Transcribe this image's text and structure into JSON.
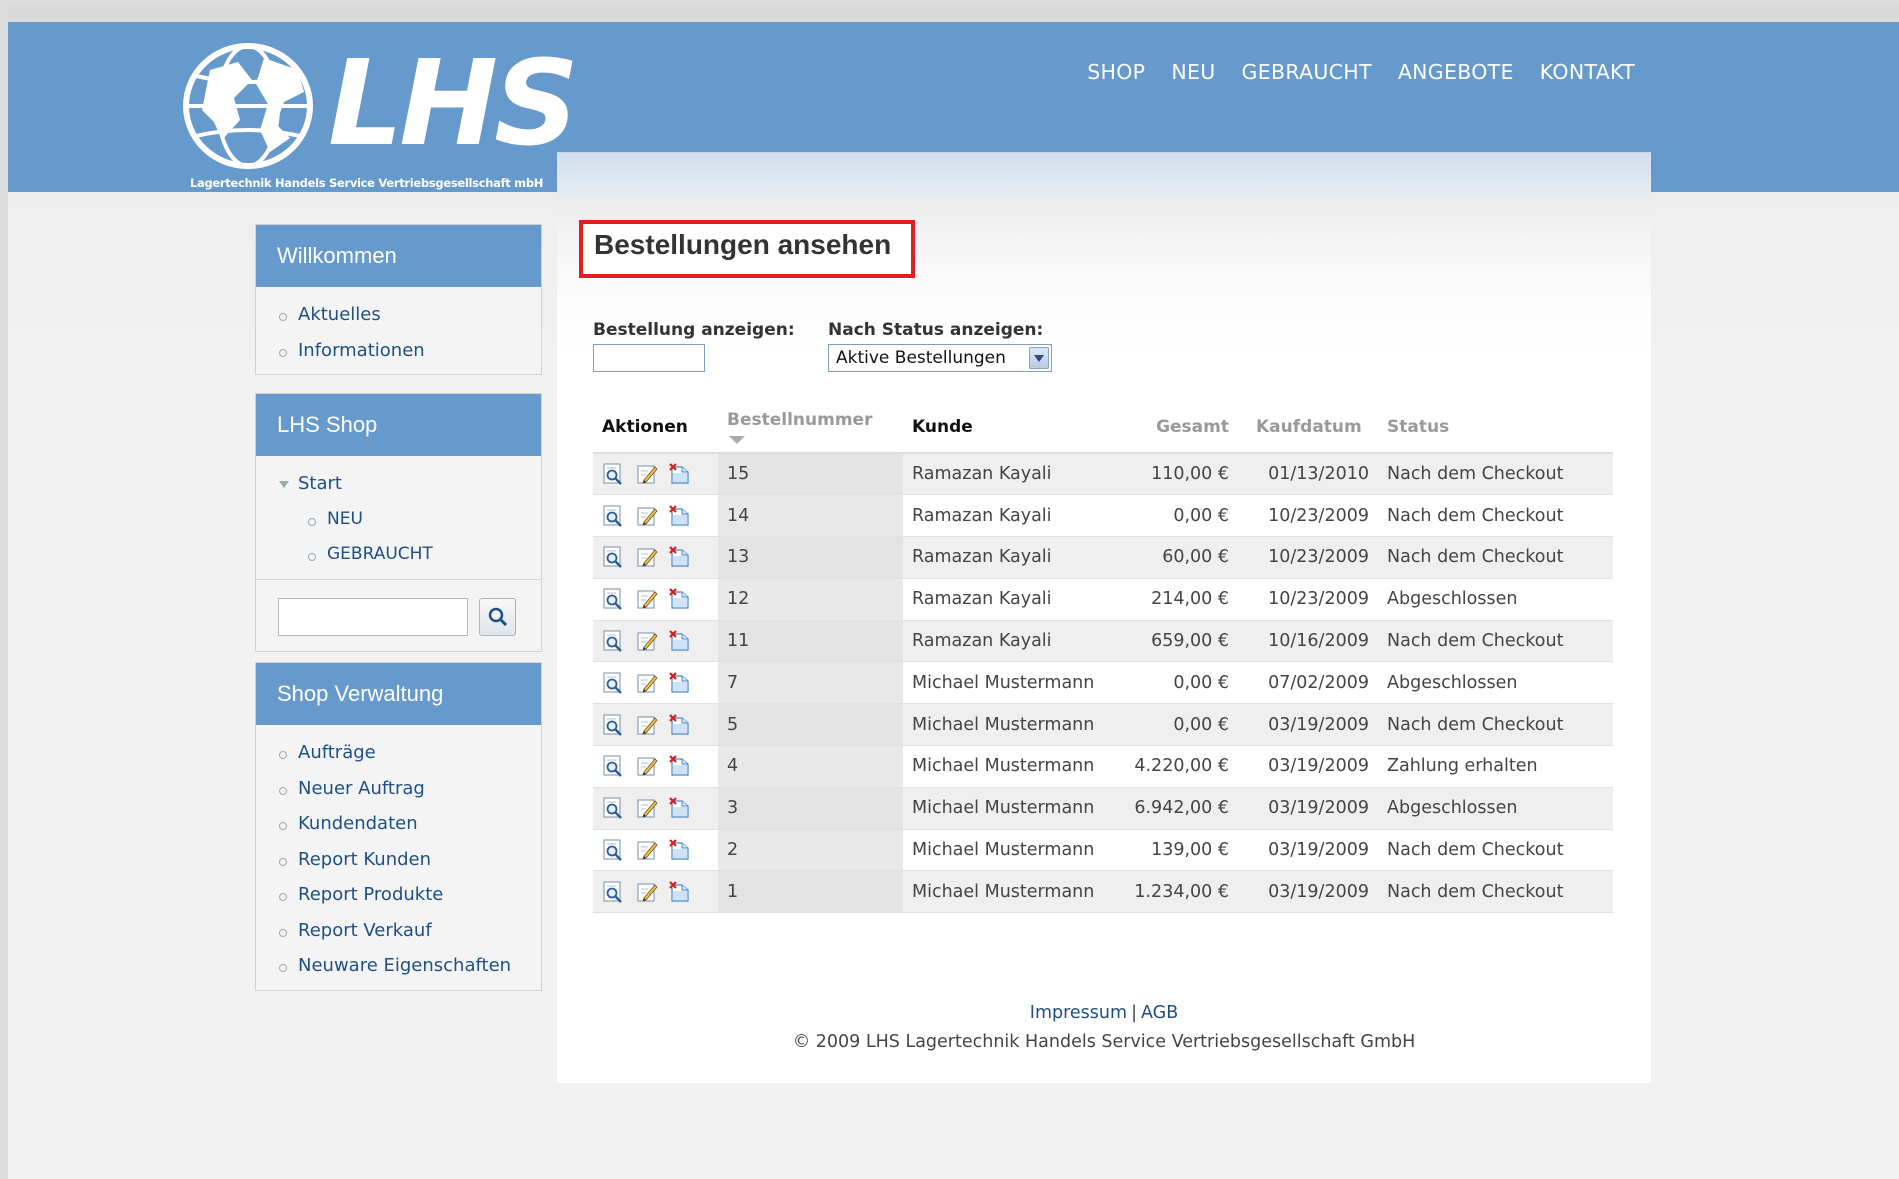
{
  "brand": {
    "logo_text": "LHS",
    "tagline": "Lagertechnik Handels Service Vertriebsgesellschaft mbH"
  },
  "topnav": [
    "SHOP",
    "NEU",
    "GEBRAUCHT",
    "ANGEBOTE",
    "KONTAKT"
  ],
  "sidebar": {
    "welcome": {
      "title": "Willkommen",
      "items": [
        "Aktuelles",
        "Informationen"
      ]
    },
    "shop": {
      "title": "LHS Shop",
      "start": "Start",
      "subitems": [
        "NEU",
        "GEBRAUCHT"
      ],
      "search_value": ""
    },
    "admin": {
      "title": "Shop Verwaltung",
      "items": [
        "Aufträge",
        "Neuer Auftrag",
        "Kundendaten",
        "Report Kunden",
        "Report Produkte",
        "Report Verkauf",
        "Neuware Eigenschaften"
      ]
    }
  },
  "main": {
    "title": "Bestellungen ansehen",
    "filter_order_label": "Bestellung anzeigen:",
    "filter_order_value": "",
    "filter_status_label": "Nach Status anzeigen:",
    "filter_status_selected": "Aktive Bestellungen",
    "columns": {
      "actions": "Aktionen",
      "order_number": "Bestellnummer",
      "customer": "Kunde",
      "total": "Gesamt",
      "date": "Kaufdatum",
      "status": "Status"
    },
    "rows": [
      {
        "id": "15",
        "customer": "Ramazan Kayali",
        "total": "110,00 €",
        "date": "01/13/2010",
        "status": "Nach dem Checkout"
      },
      {
        "id": "14",
        "customer": "Ramazan Kayali",
        "total": "0,00 €",
        "date": "10/23/2009",
        "status": "Nach dem Checkout"
      },
      {
        "id": "13",
        "customer": "Ramazan Kayali",
        "total": "60,00 €",
        "date": "10/23/2009",
        "status": "Nach dem Checkout"
      },
      {
        "id": "12",
        "customer": "Ramazan Kayali",
        "total": "214,00 €",
        "date": "10/23/2009",
        "status": "Abgeschlossen"
      },
      {
        "id": "11",
        "customer": "Ramazan Kayali",
        "total": "659,00 €",
        "date": "10/16/2009",
        "status": "Nach dem Checkout"
      },
      {
        "id": "7",
        "customer": "Michael Mustermann",
        "total": "0,00 €",
        "date": "07/02/2009",
        "status": "Abgeschlossen"
      },
      {
        "id": "5",
        "customer": "Michael Mustermann",
        "total": "0,00 €",
        "date": "03/19/2009",
        "status": "Nach dem Checkout"
      },
      {
        "id": "4",
        "customer": "Michael Mustermann",
        "total": "4.220,00 €",
        "date": "03/19/2009",
        "status": "Zahlung erhalten"
      },
      {
        "id": "3",
        "customer": "Michael Mustermann",
        "total": "6.942,00 €",
        "date": "03/19/2009",
        "status": "Abgeschlossen"
      },
      {
        "id": "2",
        "customer": "Michael Mustermann",
        "total": "139,00 €",
        "date": "03/19/2009",
        "status": "Nach dem Checkout"
      },
      {
        "id": "1",
        "customer": "Michael Mustermann",
        "total": "1.234,00 €",
        "date": "03/19/2009",
        "status": "Nach dem Checkout"
      }
    ]
  },
  "footer": {
    "impressum": "Impressum",
    "separator": "|",
    "agb": "AGB",
    "copyright": "© 2009 LHS Lagertechnik Handels Service Vertriebsgesellschaft GmbH"
  },
  "icons": {
    "view": "magnifier-icon",
    "edit": "edit-icon",
    "delete": "delete-icon",
    "search": "search-icon"
  },
  "colors": {
    "brand_blue": "#6699cc",
    "link": "#1e4f86",
    "highlight": "#e02020"
  }
}
